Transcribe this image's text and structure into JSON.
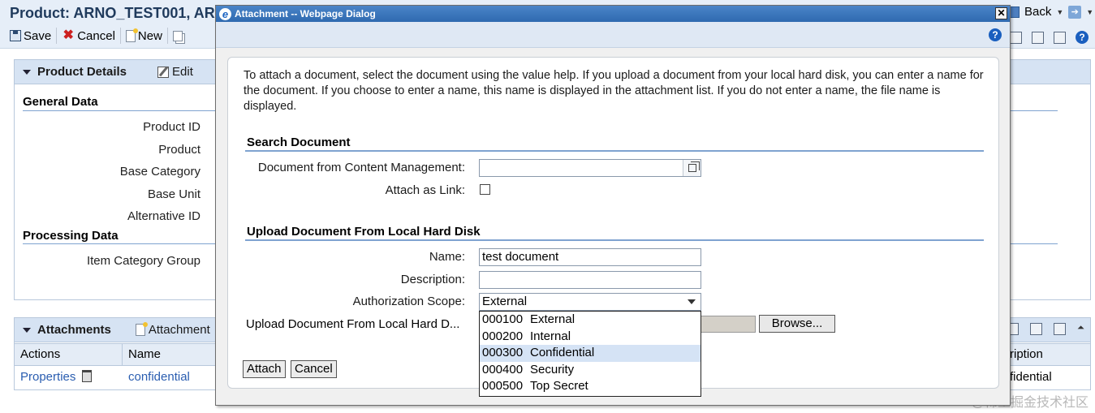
{
  "app": {
    "title": "Product: ARNO_TEST001, AR",
    "toolbar": {
      "save": "Save",
      "cancel": "Cancel",
      "new": "New"
    },
    "nav": {
      "back": "Back"
    },
    "product_details": {
      "header": "Product Details",
      "edit": "Edit",
      "general_data": "General Data",
      "labels": [
        "Product ID",
        "Product",
        "Base Category",
        "Base Unit",
        "Alternative ID"
      ],
      "processing_data": "Processing Data",
      "processing_labels": [
        "Item Category Group"
      ]
    },
    "attachments": {
      "header": "Attachments",
      "add": "Attachment",
      "columns": {
        "actions": "Actions",
        "name": "Name",
        "description": "ription"
      },
      "row": {
        "action": "Properties",
        "name": "confidential",
        "description": "fidential"
      }
    }
  },
  "dialog": {
    "title": "Attachment -- Webpage Dialog",
    "intro": "To attach a document, select the document using the value help. If you upload a document from your local hard disk, you can enter a name for the document. If you choose to enter a name, this name is displayed in the attachment list. If you do not enter a name, the file name is displayed.",
    "search_section": "Search Document",
    "doc_from_cm_label": "Document from Content Management:",
    "doc_from_cm_value": "",
    "attach_as_link_label": "Attach as Link:",
    "upload_section": "Upload Document From Local Hard Disk",
    "name_label": "Name:",
    "name_value": "test document",
    "description_label": "Description:",
    "description_value": "",
    "auth_scope_label": "Authorization Scope:",
    "auth_scope_value": "External",
    "upload_label": "Upload Document From Local Hard D...",
    "browse": "Browse...",
    "attach": "Attach",
    "cancel": "Cancel",
    "auth_options": [
      {
        "code": "000100",
        "label": "External"
      },
      {
        "code": "000200",
        "label": "Internal"
      },
      {
        "code": "000300",
        "label": "Confidential"
      },
      {
        "code": "000400",
        "label": "Security"
      },
      {
        "code": "000500",
        "label": "Top Secret"
      }
    ]
  },
  "watermark": "@稀土掘金技术社区"
}
